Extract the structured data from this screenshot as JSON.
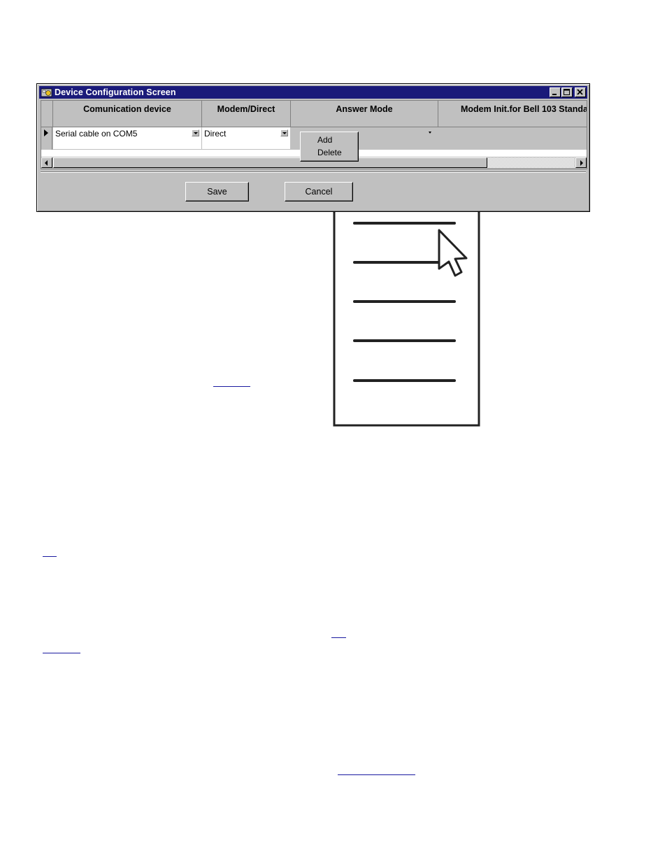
{
  "window": {
    "title": "Device Configuration Screen",
    "controls": {
      "minimize": "_",
      "maximize": "□",
      "close": "✕"
    }
  },
  "grid": {
    "columns": [
      "Comunication device",
      "Modem/Direct",
      "Answer Mode",
      "Modem Init.for Bell 103 Standa"
    ],
    "rows": [
      {
        "communication_device": "Serial cable on COM5",
        "modem_direct": "Direct",
        "answer_mode": "",
        "modem_init": ""
      }
    ]
  },
  "context_menu": {
    "items": [
      "Add",
      "Delete"
    ]
  },
  "buttons": {
    "save": "Save",
    "cancel": "Cancel"
  },
  "icons": [
    "app-icon",
    "minimize-icon",
    "maximize-icon",
    "close-icon",
    "row-selector-icon",
    "dropdown-arrow-icon",
    "scroll-left-icon",
    "scroll-right-icon",
    "list-document-icon",
    "mouse-pointer-icon"
  ],
  "colors": {
    "titlebar": "#1a1a7a",
    "face": "#c0c0c0",
    "link": "#1a1aa0"
  }
}
